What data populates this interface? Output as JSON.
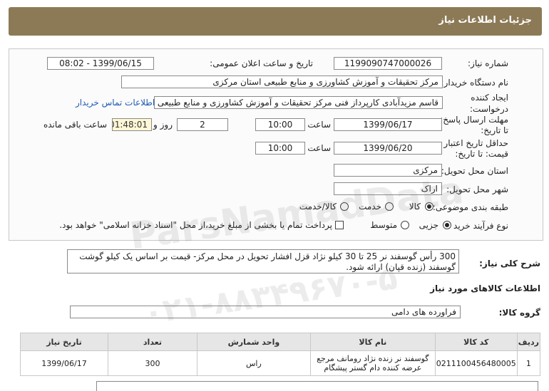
{
  "header": {
    "title": "جزئیات اطلاعات نیاز"
  },
  "form": {
    "need_number_label": "شماره نیاز:",
    "need_number": "1199090747000026",
    "announce_label": "تاریخ و ساعت اعلان عمومی:",
    "announce_value": "1399/06/15 - 08:02",
    "buyer_label": "نام دستگاه خریدار:",
    "buyer_value": "مرکز تحقیقات و آموزش کشاورزی و منابع طبیعی استان مرکزی",
    "creator_label_1": "ایجاد کننده",
    "creator_label_2": "درخواست:",
    "creator_value": "قاسم مزیدآبادی کارپرداز فنی مرکز تحقیقات و آموزش کشاورزی و منابع طبیعی ا",
    "contact_link": "اطلاعات تماس خریدار",
    "reply_deadline_label_1": "مهلت ارسال پاسخ:",
    "reply_deadline_label_2": "تا تاریخ:",
    "reply_date": "1399/06/17",
    "time_label": "ساعت",
    "reply_time": "10:00",
    "days_value": "2",
    "days_label": "روز و",
    "remaining_time": "01:48:01",
    "remaining_label": "ساعت باقی مانده",
    "validity_label_1": "حداقل تاریخ اعتبار",
    "validity_label_2": "قیمت: تا تاریخ:",
    "validity_date": "1399/06/20",
    "validity_time": "10:00",
    "province_label": "استان محل تحویل:",
    "province_value": "مرکزی",
    "city_label": "شهر محل تحویل:",
    "city_value": "اراک",
    "category_label": "طبقه بندی موضوعی:",
    "category_goods": "کالا",
    "category_service": "خدمت",
    "category_goods_service": "کالا/خدمت",
    "process_label": "نوع فرآیند خرید :",
    "process_partial": "جزیی",
    "process_medium": "متوسط",
    "payment_note": "پرداخت تمام یا بخشی از مبلغ خرید،از محل \"اسناد خزانه اسلامی\" خواهد بود."
  },
  "description": {
    "label": "شرح کلی نیاز:",
    "text": "300 رأس گوسفند نر 25 تا 30 کیلو نژاد قزل افشار تحویل در محل مرکز- قیمت بر اساس یک کیلو گوشت گوسفند (زنده قپان) ارائه شود."
  },
  "goods_info": {
    "section_title": "اطلاعات کالاهای مورد نیاز",
    "group_label": "گروه کالا:",
    "group_value": "فراورده های دامی"
  },
  "table": {
    "headers": [
      "ردیف",
      "کد کالا",
      "نام کالا",
      "واحد شمارش",
      "تعداد",
      "تاریخ نیاز"
    ],
    "rows": [
      [
        "1",
        "0211100456480005",
        "گوسفند نر زنده نژاد رومانف مرجع عرضه کننده دام گستر پیشگام",
        "راس",
        "300",
        "1399/06/17"
      ]
    ]
  },
  "watermark": {
    "line1": "ParsNamadData",
    "line2": "۰۲۱-۸۸۳۴۹۶۷۰-۵"
  }
}
